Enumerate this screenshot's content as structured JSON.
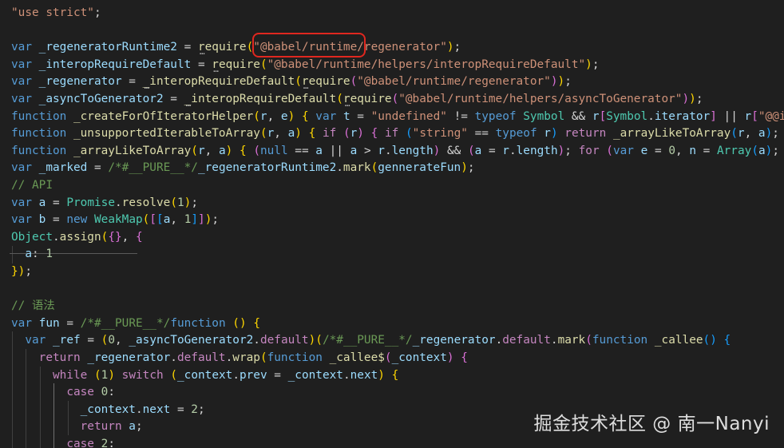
{
  "editor": {
    "background": "#1f1f1f",
    "highlight_color": "#e0271f",
    "lines": [
      "\"use strict\";",
      "",
      "var _regeneratorRuntime2 = require(\"@babel/runtime/regenerator\");",
      "var _interopRequireDefault = require(\"@babel/runtime/helpers/interopRequireDefault\");",
      "var _regenerator = _interopRequireDefault(require(\"@babel/runtime/regenerator\"));",
      "var _asyncToGenerator2 = _interopRequireDefault(require(\"@babel/runtime/helpers/asyncToGenerator\"));",
      "function _createForOfIteratorHelper(r, e) { var t = \"undefined\" != typeof Symbol && r[Symbol.iterator] || r[\"@@i",
      "function _unsupportedIterableToArray(r, a) { if (r) { if (\"string\" == typeof r) return _arrayLikeToArray(r, a);",
      "function _arrayLikeToArray(r, a) { (null == a || a > r.length) && (a = r.length); for (var e = 0, n = Array(a);",
      "var _marked = /*#__PURE__*/_regeneratorRuntime2.mark(gennerateFun);",
      "// API",
      "var a = Promise.resolve(1);",
      "var b = new WeakMap([[a, 1]]);",
      "Object.assign({}, {",
      "  a: 1",
      "});",
      "",
      "// 语法",
      "var fun = /*#__PURE__*/function () {",
      "  var _ref = (0, _asyncToGenerator2.default)(/*#__PURE__*/_regenerator.default.mark(function _callee() {",
      "    return _regenerator.default.wrap(function _callee$(_context) {",
      "      while (1) switch (_context.prev = _context.next) {",
      "        case 0:",
      "          _context.next = 2;",
      "          return a;",
      "        case 2:"
    ]
  },
  "watermark": "掘金技术社区 @ 南一Nanyi"
}
